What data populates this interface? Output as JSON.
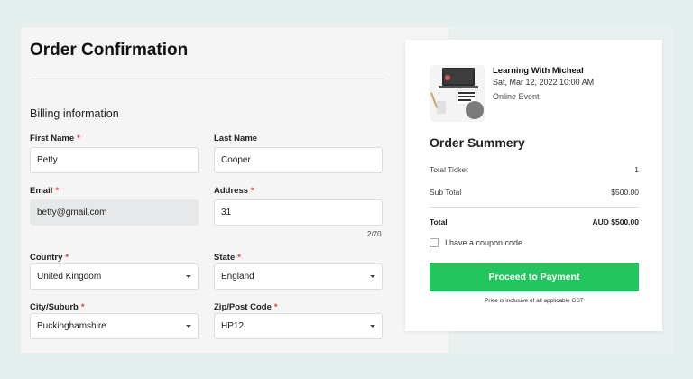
{
  "page": {
    "title": "Order Confirmation"
  },
  "billing": {
    "heading": "Billing information",
    "first_name": {
      "label": "First Name",
      "required": "*",
      "value": "Betty"
    },
    "last_name": {
      "label": "Last Name",
      "value": "Cooper"
    },
    "email": {
      "label": "Email",
      "required": "*",
      "value": "betty@gmail.com"
    },
    "address": {
      "label": "Address",
      "required": "*",
      "value": "31",
      "counter": "2/70"
    },
    "country": {
      "label": "Country",
      "required": "*",
      "value": "United Kingdom"
    },
    "state": {
      "label": "State",
      "required": "*",
      "value": "England"
    },
    "city": {
      "label": "City/Suburb",
      "required": "*",
      "value": "Buckinghamshire"
    },
    "zip": {
      "label": "Zip/Post Code",
      "required": "*",
      "value": "HP12"
    }
  },
  "event": {
    "title": "Learning With Micheal",
    "date": "Sat, Mar 12, 2022 10:00 AM",
    "type": "Online Event"
  },
  "summary": {
    "title": "Order Summery",
    "total_ticket_label": "Total Ticket",
    "total_ticket_value": "1",
    "subtotal_label": "Sub Total",
    "subtotal_value": "$500.00",
    "total_label": "Total",
    "total_value": "AUD $500.00",
    "coupon_label": "I have a coupon code",
    "pay_button": "Proceed to Payment",
    "note": "Price is inclusive of all applicable GST"
  },
  "colors": {
    "accent": "#22c55e",
    "required": "#e0353b",
    "background": "#e3eeed"
  },
  "icons": {
    "select": "chevron-down-icon"
  }
}
